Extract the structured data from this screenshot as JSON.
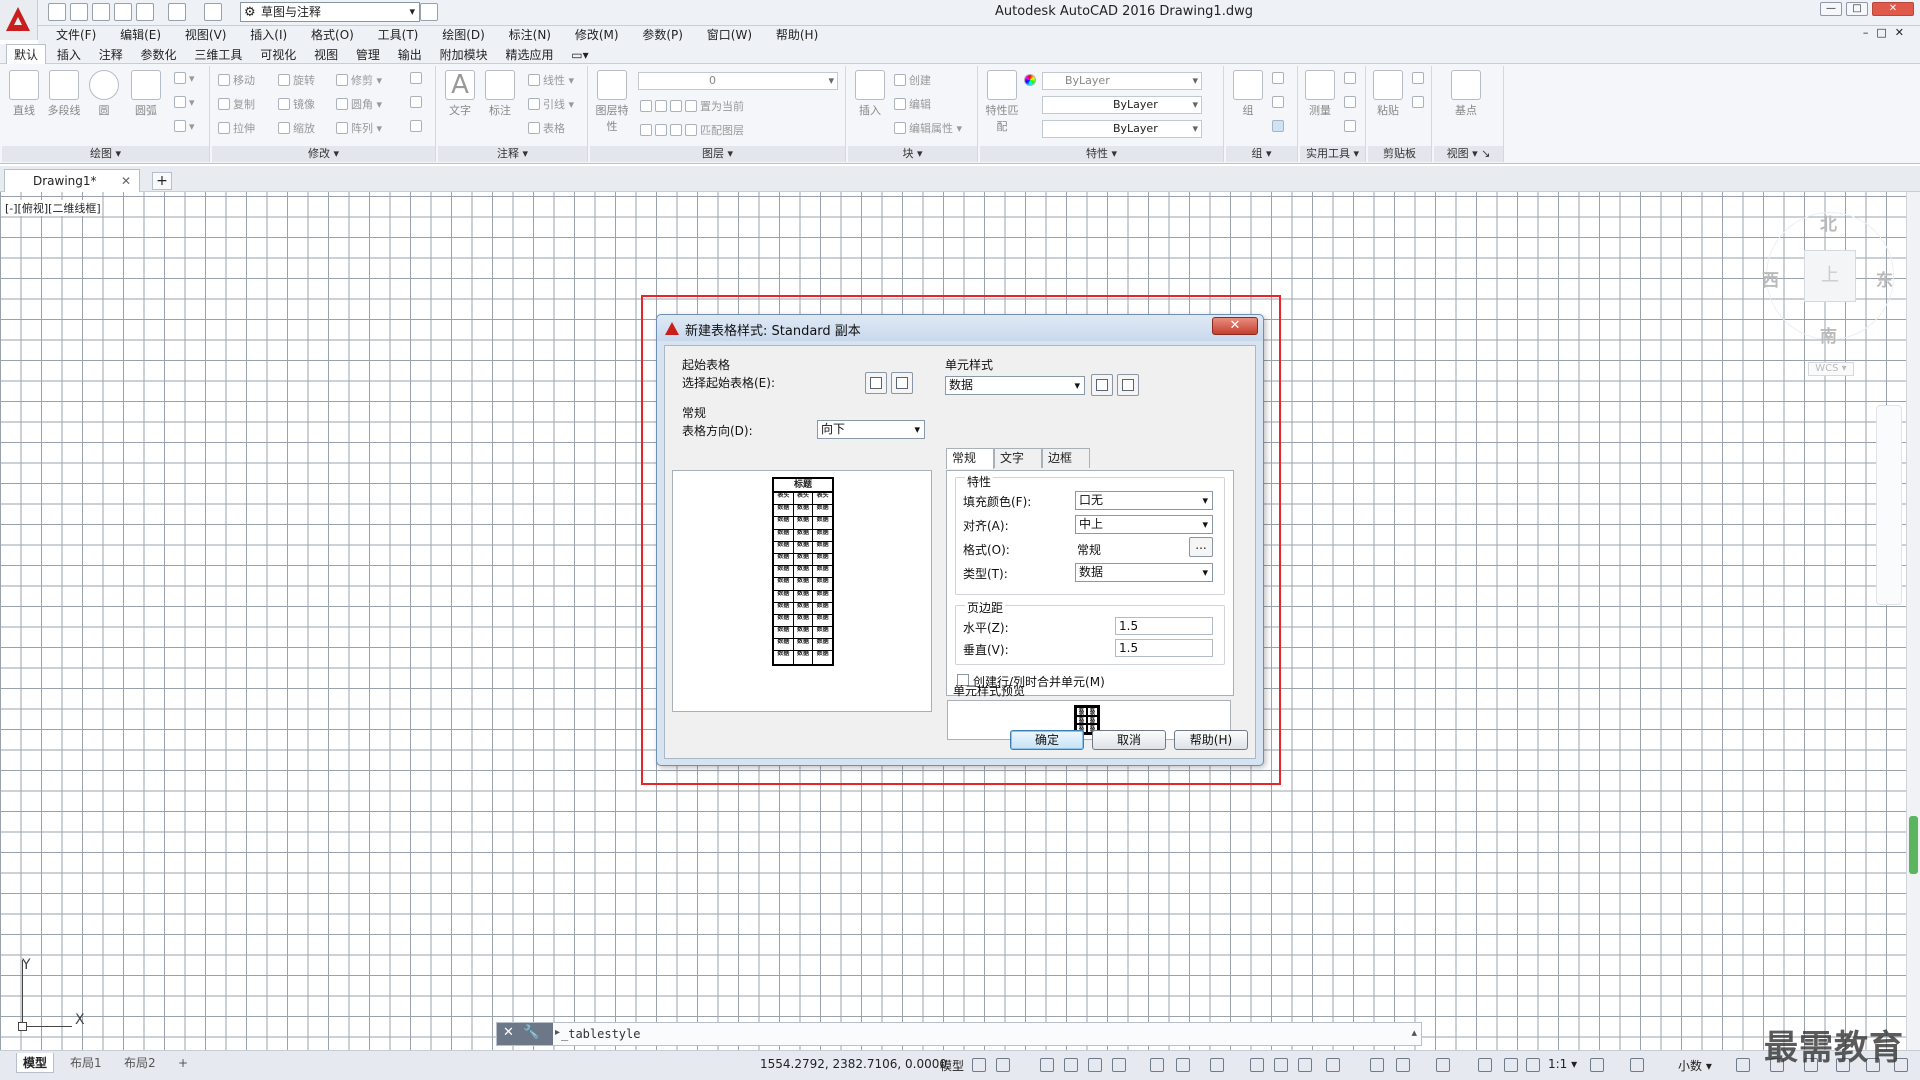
{
  "titlebar": {
    "workspace": "草图与注释",
    "app_title": "Autodesk AutoCAD 2016    Drawing1.dwg"
  },
  "menu": [
    "文件(F)",
    "编辑(E)",
    "视图(V)",
    "插入(I)",
    "格式(O)",
    "工具(T)",
    "绘图(D)",
    "标注(N)",
    "修改(M)",
    "参数(P)",
    "窗口(W)",
    "帮助(H)"
  ],
  "ribbon_tabs": [
    "默认",
    "插入",
    "注释",
    "参数化",
    "三维工具",
    "可视化",
    "视图",
    "管理",
    "输出",
    "附加模块",
    "精选应用"
  ],
  "ribbon": {
    "draw": {
      "title": "绘图",
      "buttons": [
        "直线",
        "多段线",
        "圆",
        "圆弧"
      ]
    },
    "modify": {
      "title": "修改",
      "items": [
        "移动",
        "旋转",
        "修剪",
        "复制",
        "镜像",
        "圆角",
        "拉伸",
        "缩放",
        "阵列"
      ]
    },
    "annotation": {
      "title": "注释",
      "buttons": [
        "文字",
        "标注"
      ],
      "items": [
        "线性",
        "引线",
        "表格"
      ]
    },
    "layers": {
      "title": "图层",
      "button": "图层特性",
      "layer_value": "0",
      "items": [
        "置为当前",
        "匹配图层"
      ]
    },
    "block": {
      "title": "块",
      "button": "插入",
      "items": [
        "创建",
        "编辑",
        "编辑属性"
      ]
    },
    "properties": {
      "title": "特性",
      "buttons": [
        "特性匹配"
      ],
      "color": "ByLayer",
      "linetype": "ByLayer",
      "lineweight": "ByLayer"
    },
    "groups": {
      "title": "组",
      "button": "组"
    },
    "utilities": {
      "title": "实用工具",
      "button": "测量"
    },
    "clipboard": {
      "title": "剪贴板",
      "button": "粘贴"
    },
    "view": {
      "title": "视图",
      "button": "基点"
    }
  },
  "doc_tab": "Drawing1*",
  "viewport_label": "[-][俯视][二维线框]",
  "viewcube": {
    "north": "北",
    "south": "南",
    "east": "东",
    "west": "西",
    "face": "上",
    "wcs": "WCS"
  },
  "ucs": {
    "x": "X",
    "y": "Y"
  },
  "command": {
    "value": "_tablestyle"
  },
  "layout_tabs": [
    "模型",
    "布局1",
    "布局2"
  ],
  "status": {
    "coords": "1554.2792, 2382.7106, 0.0000",
    "model": "模型",
    "scale": "1:1",
    "units": "小数"
  },
  "watermark": "最需教育",
  "dialog": {
    "title": "新建表格样式: Standard 副本",
    "starting_table": {
      "group": "起始表格",
      "label": "选择起始表格(E):"
    },
    "general": {
      "group": "常规",
      "direction_label": "表格方向(D):",
      "direction_value": "向下"
    },
    "preview_table": {
      "title": "标题",
      "header": "表头",
      "data": "数据"
    },
    "cell_style": {
      "group": "单元样式",
      "value": "数据"
    },
    "tabs": [
      "常规",
      "文字",
      "边框"
    ],
    "properties": {
      "group": "特性",
      "fill_label": "填充颜色(F):",
      "fill_value": "口无",
      "align_label": "对齐(A):",
      "align_value": "中上",
      "format_label": "格式(O):",
      "format_value": "常规",
      "format_button": "...",
      "type_label": "类型(T):",
      "type_value": "数据"
    },
    "margins": {
      "group": "页边距",
      "horizontal_label": "水平(Z):",
      "horizontal_value": "1.5",
      "vertical_label": "垂直(V):",
      "vertical_value": "1.5"
    },
    "merge_label": "创建行/列时合并单元(M)",
    "cell_preview_label": "单元样式预览",
    "buttons": {
      "ok": "确定",
      "cancel": "取消",
      "help": "帮助(H)"
    }
  }
}
